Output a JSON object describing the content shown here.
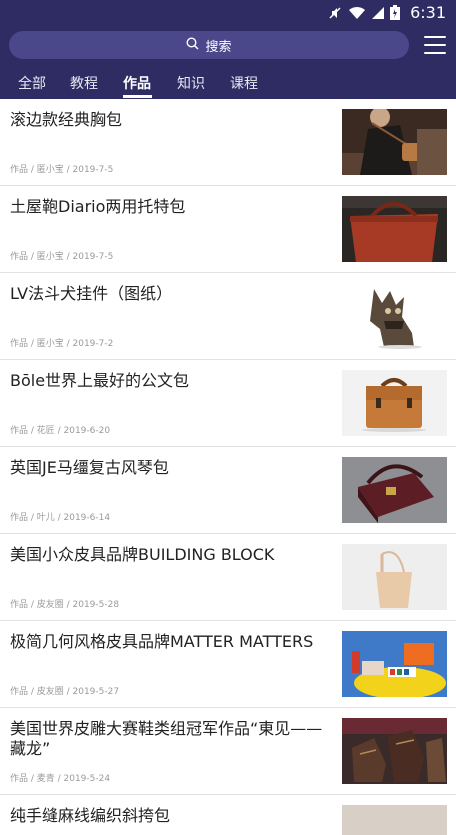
{
  "status_bar": {
    "time": "6:31"
  },
  "search": {
    "label": "搜索"
  },
  "tabs": [
    {
      "label": "全部"
    },
    {
      "label": "教程"
    },
    {
      "label": "作品"
    },
    {
      "label": "知识"
    },
    {
      "label": "课程"
    }
  ],
  "articles": [
    {
      "title": "滚边款经典胸包",
      "meta": "作品 / 匿小宝 / 2019-7-5"
    },
    {
      "title": "土屋鞄Diario两用托特包",
      "meta": "作品 / 匿小宝 / 2019-7-5"
    },
    {
      "title": "LV法斗犬挂件（图纸）",
      "meta": "作品 / 匿小宝 / 2019-7-2"
    },
    {
      "title": "Bōle世界上最好的公文包",
      "meta": "作品 / 花匠 / 2019-6-20"
    },
    {
      "title": "英国JE马缰复古风琴包",
      "meta": "作品 / 叶儿 / 2019-6-14"
    },
    {
      "title": "美国小众皮具品牌BUILDING BLOCK",
      "meta": "作品 / 皮友圈 / 2019-5-28"
    },
    {
      "title": "极简几何风格皮具品牌MATTER MATTERS",
      "meta": "作品 / 皮友圈 / 2019-5-27"
    },
    {
      "title": "美国世界皮雕大赛鞋类组冠军作品“東见——藏龙”",
      "meta": "作品 / 麦青 / 2019-5-24"
    }
  ],
  "partial_item": {
    "title": "纯手缝麻线编织斜挎包"
  },
  "colors": {
    "header": "#2f2c63",
    "search_bg": "#4a478a"
  }
}
